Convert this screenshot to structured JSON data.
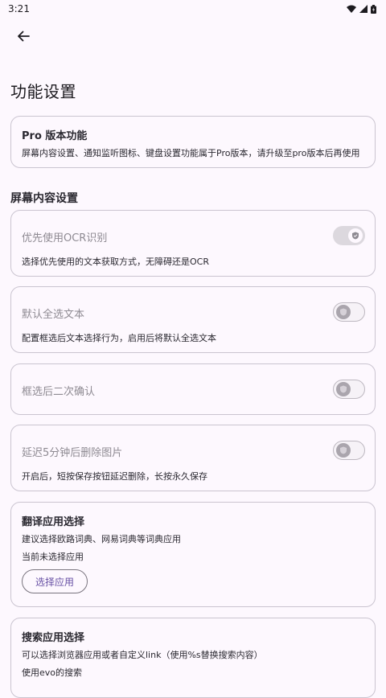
{
  "status_bar": {
    "time": "3:21"
  },
  "header": {
    "title": "功能设置"
  },
  "pro_card": {
    "title": "Pro 版本功能",
    "text": "屏幕内容设置、通知监听图标、键盘设置功能属于Pro版本，请升级至pro版本后再使用"
  },
  "section": {
    "title": "屏幕内容设置"
  },
  "settings": [
    {
      "label": "优先使用OCR识别",
      "desc": "选择优先使用的文本获取方式，无障碍还是OCR",
      "state": "on"
    },
    {
      "label": "默认全选文本",
      "desc": "配置框选后文本选择行为，启用后将默认全选文本",
      "state": "off"
    },
    {
      "label": "框选后二次确认",
      "desc": "",
      "state": "off"
    },
    {
      "label": "延迟5分钟后删除图片",
      "desc": "开启后，短按保存按钮延迟删除，长按永久保存",
      "state": "off"
    }
  ],
  "translate_card": {
    "title": "翻译应用选择",
    "desc": "建议选择欧路词典、网易词典等词典应用",
    "current": "当前未选择应用",
    "button": "选择应用"
  },
  "search_card": {
    "title": "搜索应用选择",
    "desc": "可以选择浏览器应用或者自定义link（使用%s替换搜索内容）",
    "current": "使用evo的搜索"
  }
}
